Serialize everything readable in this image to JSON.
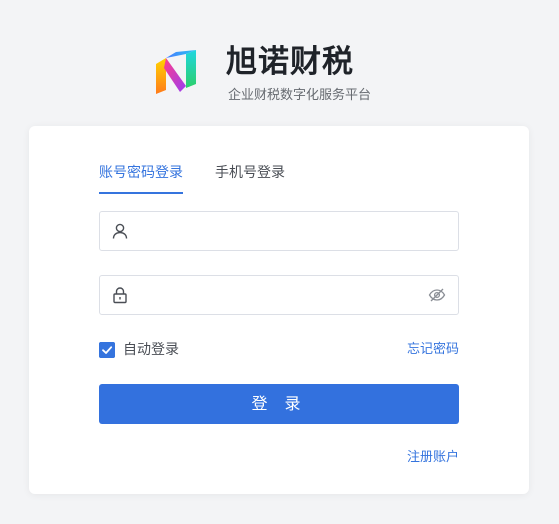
{
  "brand": {
    "name": "旭诺财税",
    "slogan": "企业财税数字化服务平台"
  },
  "login": {
    "tabs": [
      {
        "label": "账号密码登录",
        "active": true
      },
      {
        "label": "手机号登录",
        "active": false
      }
    ],
    "username": {
      "value": "",
      "placeholder": "",
      "icon": "user-icon"
    },
    "password": {
      "value": "",
      "placeholder": "",
      "icon": "lock-icon",
      "toggle_icon": "eye-off-icon"
    },
    "remember_label": "自动登录",
    "remember_checked": true,
    "forgot_label": "忘记密码",
    "submit_label": "登 录",
    "register_label": "注册账户"
  },
  "colors": {
    "accent": "#3574de",
    "button": "#3371de",
    "page_bg": "#f3f4f6",
    "card_bg": "#ffffff"
  }
}
